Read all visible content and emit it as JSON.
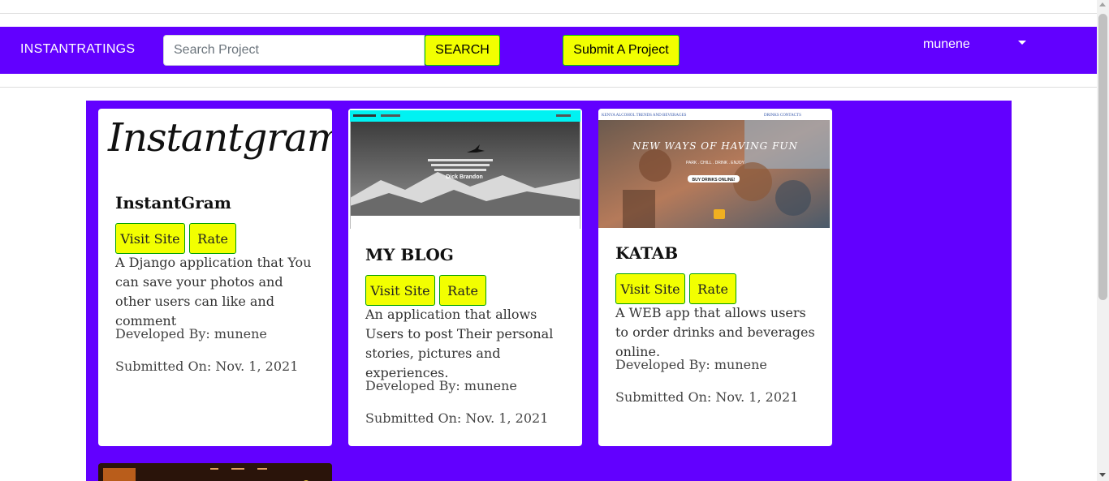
{
  "navbar": {
    "brand": "INSTANTRATINGS",
    "search_placeholder": "Search Project",
    "search_button": "SEARCH",
    "submit_button": "Submit A Project",
    "user_name": "munene",
    "caret_icon": "caret-down-icon"
  },
  "projects": [
    {
      "logo_text": "Instantgram",
      "title": "InstantGram",
      "visit_label": "Visit Site",
      "rate_label": "Rate",
      "description": "A Django application that You can save your photos and other users can like and comment",
      "developer": "Developed By: munene",
      "submitted": "Submitted On: Nov. 1, 2021"
    },
    {
      "title": "MY BLOG",
      "visit_label": "Visit Site",
      "rate_label": "Rate",
      "description": "An application that allows Users to post Their personal stories, pictures and experiences.",
      "developer": "Developed By: munene",
      "submitted": "Submitted On: Nov. 1, 2021",
      "screenshot_quote_author": "Dick Brandon"
    },
    {
      "title": "KATAB",
      "visit_label": "Visit Site",
      "rate_label": "Rate",
      "description": "A WEB app that allows users to order drinks and beverages online.",
      "developer": "Developed By: munene",
      "submitted": "Submitted On: Nov. 1, 2021",
      "screenshot_header": "KENYA ALCOHOL TRENDS AND BEVERAGES",
      "screenshot_nav": "DRINKS   CONTACTS",
      "screenshot_hero": "NEW WAYS OF HAVING FUN",
      "screenshot_sub": "PARK . CHILL . DRINK . ENJOY",
      "screenshot_button": "BUY DRINKS ONLINE!"
    }
  ],
  "colors": {
    "navbar": "#6200ff",
    "button": "#f2ff00",
    "button_border": "#00c800"
  }
}
